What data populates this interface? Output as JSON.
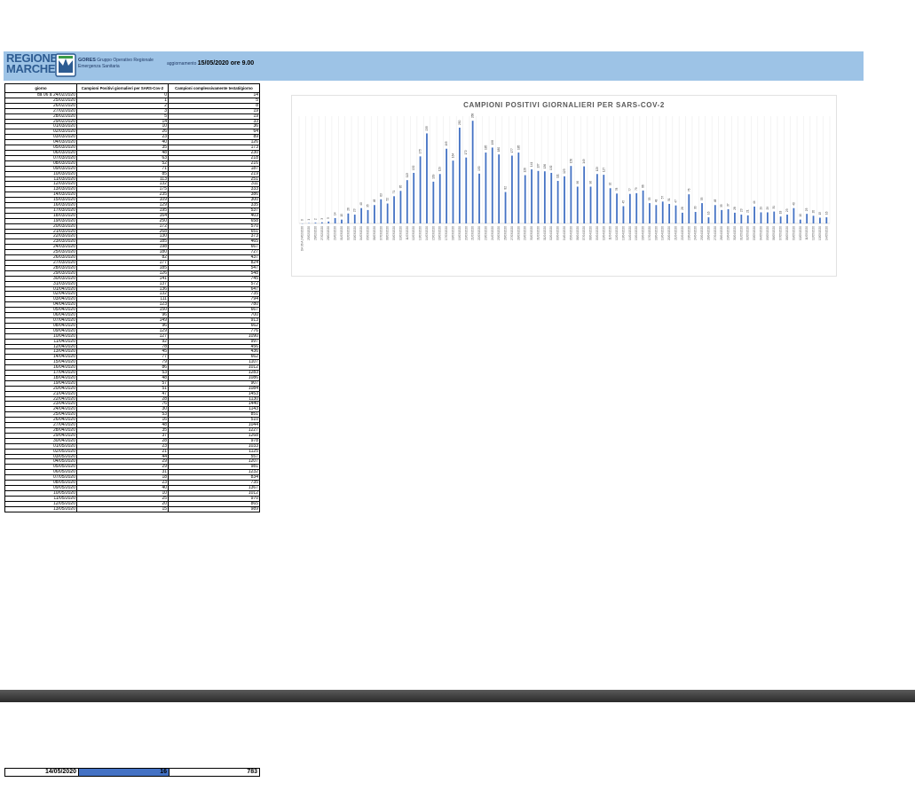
{
  "header": {
    "logo_line1": "REGIONE",
    "logo_line2": "MARCHE",
    "gores_label": "GORES",
    "gores_desc": "Gruppo Operativo Regionale Emergenza Sanitaria",
    "update_prefix": "aggiornamento",
    "update_value": "15/05/2020 ore 9.00",
    "colors": {
      "band": "#9dc3e6",
      "logo": "#2e5c92"
    }
  },
  "table": {
    "columns": [
      "giorno",
      "Campioni Positivi giornalieri per SARS-Cov-2",
      "Campioni complessivamente testati/giorno"
    ],
    "rows": [
      [
        "da 06 a 24/02/2020",
        "0",
        "14"
      ],
      [
        "25/02/2020",
        "1",
        "5"
      ],
      [
        "26/02/2020",
        "2",
        "8"
      ],
      [
        "27/02/2020",
        "3",
        "19"
      ],
      [
        "28/02/2020",
        "5",
        "19"
      ],
      [
        "29/02/2020",
        "14",
        "33"
      ],
      [
        "01/03/2020",
        "10",
        "36"
      ],
      [
        "02/03/2020",
        "26",
        "64"
      ],
      [
        "03/03/2020",
        "23",
        "89"
      ],
      [
        "04/03/2020",
        "40",
        "126"
      ],
      [
        "05/03/2020",
        "35",
        "173"
      ],
      [
        "06/03/2020",
        "48",
        "230"
      ],
      [
        "07/03/2020",
        "63",
        "218"
      ],
      [
        "08/03/2020",
        "52",
        "216"
      ],
      [
        "09/03/2020",
        "71",
        "187"
      ],
      [
        "10/03/2020",
        "85",
        "219"
      ],
      [
        "11/03/2020",
        "113",
        "251"
      ],
      [
        "12/03/2020",
        "132",
        "311"
      ],
      [
        "13/03/2020",
        "175",
        "333"
      ],
      [
        "14/03/2020",
        "235",
        "386"
      ],
      [
        "15/03/2020",
        "109",
        "300"
      ],
      [
        "16/03/2020",
        "129",
        "335"
      ],
      [
        "17/03/2020",
        "195",
        "537"
      ],
      [
        "18/03/2020",
        "164",
        "403"
      ],
      [
        "19/03/2020",
        "250",
        "658"
      ],
      [
        "20/03/2020",
        "172",
        "570"
      ],
      [
        "21/03/2020",
        "268",
        "651"
      ],
      [
        "22/03/2020",
        "130",
        "373"
      ],
      [
        "23/03/2020",
        "185",
        "465"
      ],
      [
        "24/03/2020",
        "198",
        "667"
      ],
      [
        "25/03/2020",
        "180",
        "727"
      ],
      [
        "26/03/2020",
        "82",
        "437"
      ],
      [
        "27/03/2020",
        "177",
        "824"
      ],
      [
        "28/03/2020",
        "185",
        "547"
      ],
      [
        "29/03/2020",
        "126",
        "548"
      ],
      [
        "30/03/2020",
        "141",
        "745"
      ],
      [
        "31/03/2020",
        "137",
        "572"
      ],
      [
        "01/04/2020",
        "136",
        "647"
      ],
      [
        "02/04/2020",
        "132",
        "735"
      ],
      [
        "03/04/2020",
        "111",
        "794"
      ],
      [
        "04/04/2020",
        "123",
        "780"
      ],
      [
        "05/04/2020",
        "150",
        "667"
      ],
      [
        "06/04/2020",
        "96",
        "700"
      ],
      [
        "07/04/2020",
        "149",
        "913"
      ],
      [
        "08/04/2020",
        "96",
        "662"
      ],
      [
        "09/04/2020",
        "129",
        "776"
      ],
      [
        "10/04/2020",
        "127",
        "1090"
      ],
      [
        "11/04/2020",
        "92",
        "997"
      ],
      [
        "12/04/2020",
        "78",
        "456"
      ],
      [
        "13/04/2020",
        "45",
        "436"
      ],
      [
        "14/04/2020",
        "77",
        "662"
      ],
      [
        "15/04/2020",
        "79",
        "1107"
      ],
      [
        "16/04/2020",
        "86",
        "1012"
      ],
      [
        "17/04/2020",
        "53",
        "1283"
      ],
      [
        "18/04/2020",
        "48",
        "1086"
      ],
      [
        "19/04/2020",
        "57",
        "907"
      ],
      [
        "20/04/2020",
        "51",
        "1084"
      ],
      [
        "21/04/2020",
        "47",
        "1453"
      ],
      [
        "22/04/2020",
        "28",
        "1130"
      ],
      [
        "23/04/2020",
        "76",
        "1440"
      ],
      [
        "24/04/2020",
        "30",
        "1143"
      ],
      [
        "25/04/2020",
        "53",
        "851"
      ],
      [
        "26/04/2020",
        "16",
        "510"
      ],
      [
        "27/04/2020",
        "48",
        "1044"
      ],
      [
        "28/04/2020",
        "35",
        "1227"
      ],
      [
        "29/04/2020",
        "37",
        "1268"
      ],
      [
        "30/04/2020",
        "28",
        "978"
      ],
      [
        "01/05/2020",
        "23",
        "1033"
      ],
      [
        "02/05/2020",
        "21",
        "1125"
      ],
      [
        "03/05/2020",
        "44",
        "557"
      ],
      [
        "04/05/2020",
        "29",
        "1207"
      ],
      [
        "05/05/2020",
        "29",
        "981"
      ],
      [
        "06/05/2020",
        "31",
        "1232"
      ],
      [
        "07/05/2020",
        "18",
        "834"
      ],
      [
        "08/05/2020",
        "23",
        "735"
      ],
      [
        "09/05/2020",
        "40",
        "1367"
      ],
      [
        "10/05/2020",
        "10",
        "1012"
      ],
      [
        "11/05/2020",
        "25",
        "970"
      ],
      [
        "12/05/2020",
        "20",
        "865"
      ],
      [
        "13/05/2020",
        "15",
        "989"
      ]
    ]
  },
  "bottom_row": {
    "date": "14/05/2020",
    "positives": "16",
    "tested": "783"
  },
  "chart_data": {
    "type": "bar",
    "title": "CAMPIONI POSITIVI GIORNALIERI PER SARS-COV-2",
    "categories": [
      "DA 06 A 24/02/2020",
      "25/02/2020",
      "26/02/2020",
      "27/02/2020",
      "28/02/2020",
      "29/02/2020",
      "01/03/2020",
      "02/03/2020",
      "03/03/2020",
      "04/03/2020",
      "05/03/2020",
      "06/03/2020",
      "07/03/2020",
      "08/03/2020",
      "09/03/2020",
      "10/03/2020",
      "11/03/2020",
      "12/03/2020",
      "13/03/2020",
      "14/03/2020",
      "15/03/2020",
      "16/03/2020",
      "17/03/2020",
      "18/03/2020",
      "19/03/2020",
      "20/03/2020",
      "21/03/2020",
      "22/03/2020",
      "23/03/2020",
      "24/03/2020",
      "25/03/2020",
      "26/03/2020",
      "27/03/2020",
      "28/03/2020",
      "29/03/2020",
      "30/03/2020",
      "31/03/2020",
      "01/04/2020",
      "02/04/2020",
      "03/04/2020",
      "04/04/2020",
      "05/04/2020",
      "06/04/2020",
      "07/04/2020",
      "08/04/2020",
      "09/04/2020",
      "10/04/2020",
      "11/04/2020",
      "12/04/2020",
      "13/04/2020",
      "14/04/2020",
      "15/04/2020",
      "16/04/2020",
      "17/04/2020",
      "18/04/2020",
      "19/04/2020",
      "20/04/2020",
      "21/04/2020",
      "22/04/2020",
      "23/04/2020",
      "24/04/2020",
      "25/04/2020",
      "26/04/2020",
      "27/04/2020",
      "28/04/2020",
      "29/04/2020",
      "30/04/2020",
      "01/05/2020",
      "02/05/2020",
      "03/05/2020",
      "04/05/2020",
      "05/05/2020",
      "06/05/2020",
      "07/05/2020",
      "08/05/2020",
      "09/05/2020",
      "10/05/2020",
      "11/05/2020",
      "12/05/2020",
      "13/05/2020",
      "14/05/2020"
    ],
    "values": [
      0,
      1,
      2,
      3,
      5,
      14,
      10,
      26,
      23,
      40,
      35,
      48,
      63,
      52,
      71,
      85,
      113,
      132,
      175,
      235,
      109,
      129,
      195,
      164,
      250,
      172,
      268,
      130,
      185,
      198,
      180,
      82,
      177,
      185,
      126,
      141,
      137,
      136,
      132,
      111,
      123,
      150,
      96,
      149,
      96,
      129,
      127,
      92,
      78,
      45,
      77,
      79,
      86,
      53,
      48,
      57,
      51,
      47,
      28,
      76,
      30,
      53,
      16,
      48,
      35,
      37,
      28,
      23,
      21,
      44,
      29,
      29,
      31,
      18,
      23,
      40,
      10,
      25,
      20,
      15,
      16
    ],
    "ylim": [
      0,
      280
    ],
    "color": "#4472c4",
    "grid": true
  }
}
